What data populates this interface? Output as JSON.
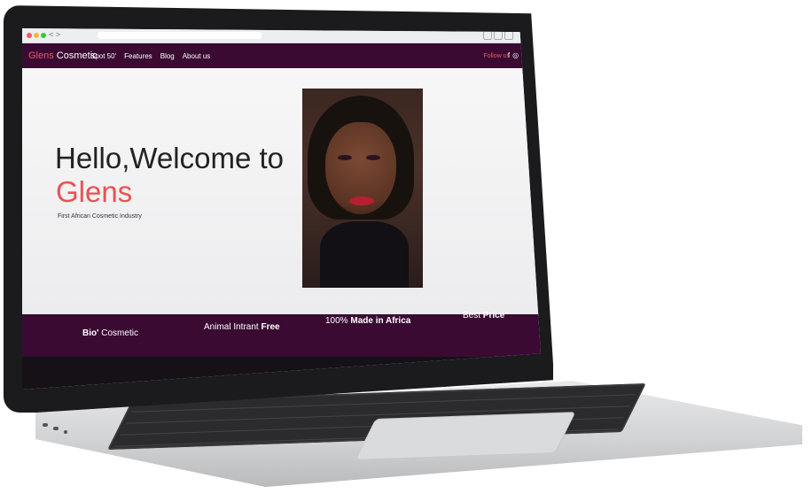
{
  "browser": {
    "back": "<",
    "forward": ">"
  },
  "navbar": {
    "brand_accent": "Glens",
    "brand_rest": " Cosmetic",
    "links": [
      "Spot 50'",
      "Features",
      "Blog",
      "About us"
    ],
    "follow_label": "Follow us",
    "social_icons": [
      "facebook-icon",
      "instagram-icon",
      "twitter-icon",
      "youtube-icon"
    ]
  },
  "hero": {
    "title_light": "Hello,",
    "title_bold": "Welcome to",
    "title_accent": "Glens",
    "tagline": "First African Cosmetic Industry"
  },
  "features": [
    {
      "strong": "Bio'",
      "rest": " Cosmetic"
    },
    {
      "pre": "Animal Intrant ",
      "strong": "Free"
    },
    {
      "pre": "100% ",
      "strong": "Made in Africa"
    },
    {
      "pre": "Best ",
      "strong": "Price"
    }
  ],
  "colors": {
    "brand_purple": "#3a0a33",
    "accent_red": "#f05a5a",
    "hero_bg": "#f4f4f6"
  }
}
